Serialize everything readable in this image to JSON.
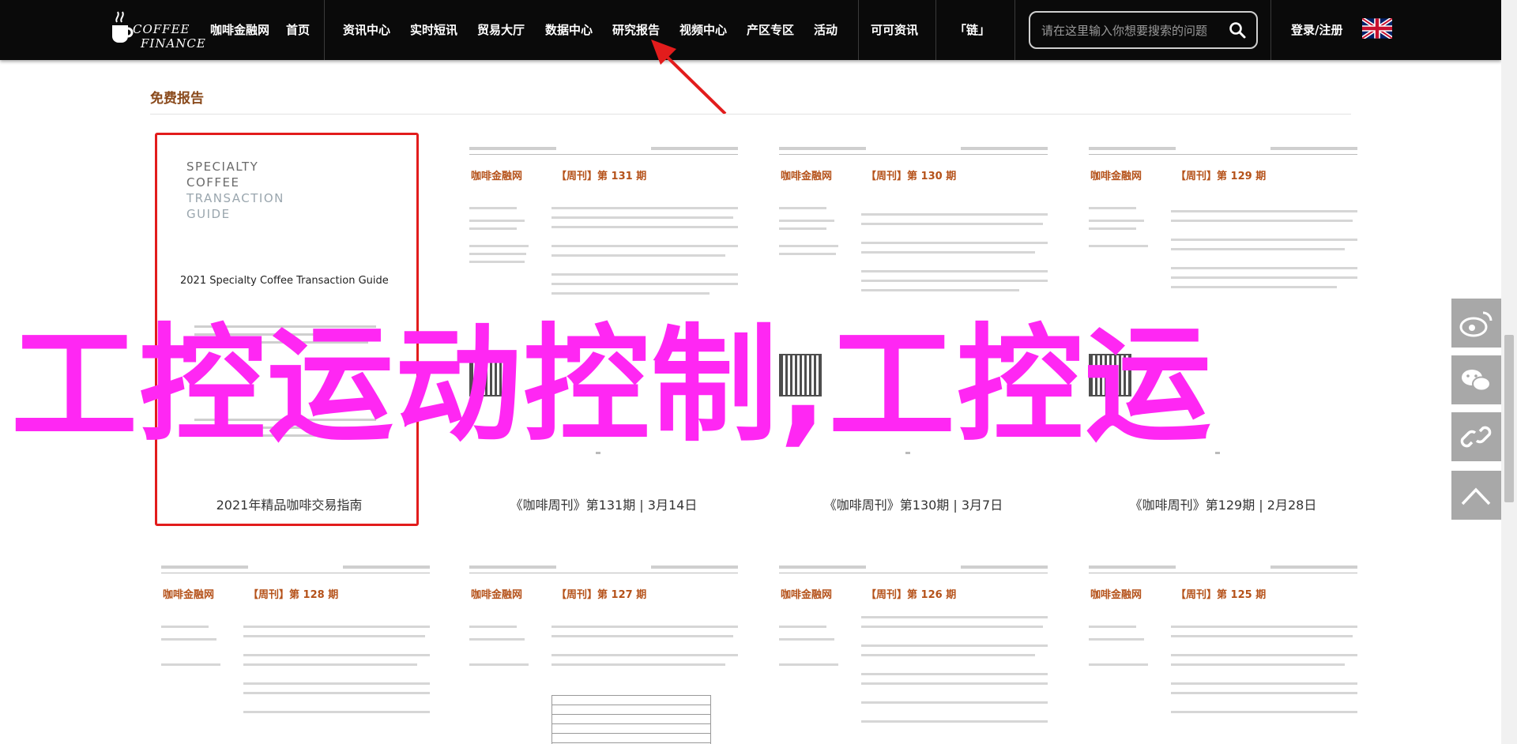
{
  "nav": {
    "logo_line1": "COFFEE",
    "logo_line2": "FINANCE",
    "items": [
      {
        "label": "咖啡金融网"
      },
      {
        "label": "首页"
      },
      {
        "label": "资讯中心"
      },
      {
        "label": "实时短讯"
      },
      {
        "label": "贸易大厅"
      },
      {
        "label": "数据中心"
      },
      {
        "label": "研究报告"
      },
      {
        "label": "视频中心"
      },
      {
        "label": "产区专区"
      },
      {
        "label": "活动"
      },
      {
        "label": "可可资讯"
      },
      {
        "label": "「链」"
      }
    ],
    "search_placeholder": "请在这里输入你想要搜索的问题",
    "login": "登录/注册",
    "icons": [
      "coffee-logo-icon",
      "search-icon",
      "uk-flag-icon"
    ]
  },
  "section": {
    "title": "免费报告"
  },
  "cover": {
    "lines": [
      "SPECIALTY",
      "COFFEE",
      "TRANSACTION",
      "GUIDE"
    ],
    "subtitle": "2021 Specialty Coffee Transaction Guide"
  },
  "newsletter": {
    "brand": "咖啡金融网"
  },
  "reports_row1": [
    {
      "title": "2021年精品咖啡交易指南",
      "issue": ""
    },
    {
      "title": "《咖啡周刊》第131期 | 3月14日",
      "issue": "【周刊】第 131 期"
    },
    {
      "title": "《咖啡周刊》第130期 | 3月7日",
      "issue": "【周刊】第 130 期"
    },
    {
      "title": "《咖啡周刊》第129期 | 2月28日",
      "issue": "【周刊】第 129 期"
    }
  ],
  "reports_row2": [
    {
      "issue": "【周刊】第 128 期"
    },
    {
      "issue": "【周刊】第 127 期"
    },
    {
      "issue": "【周刊】第 126 期"
    },
    {
      "issue": "【周刊】第 125 期"
    }
  ],
  "overlay_text": "工控运动控制,工控运",
  "side_buttons": [
    "weibo-icon",
    "wechat-icon",
    "link-icon",
    "back-to-top-icon"
  ],
  "colors": {
    "nav_bg": "#0a0a0a",
    "section_title": "#8a4a1c",
    "overlay": "#ff27f3",
    "highlight": "#e21c1c",
    "newsletter_accent": "#b5521a"
  }
}
